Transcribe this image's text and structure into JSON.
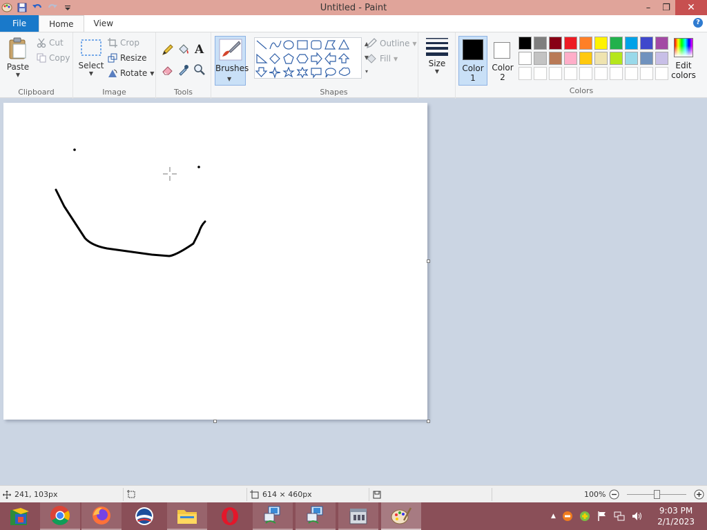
{
  "window": {
    "title": "Untitled - Paint",
    "minimize": "–",
    "restore": "❐",
    "close": "✕"
  },
  "tabs": [
    {
      "label": "File"
    },
    {
      "label": "Home"
    },
    {
      "label": "View"
    }
  ],
  "help_glyph": "?",
  "clipboard": {
    "paste": "Paste",
    "cut": "Cut",
    "copy": "Copy",
    "group": "Clipboard"
  },
  "image": {
    "select": "Select",
    "crop": "Crop",
    "resize": "Resize",
    "rotate": "Rotate",
    "group": "Image"
  },
  "tools": {
    "group": "Tools"
  },
  "brushes": {
    "label": "Brushes"
  },
  "shapes": {
    "outline": "Outline",
    "fill": "Fill",
    "group": "Shapes"
  },
  "size": {
    "label": "Size"
  },
  "colors": {
    "color1_line1": "Color",
    "color1_line2": "1",
    "color2_line1": "Color",
    "color2_line2": "2",
    "edit_line1": "Edit",
    "edit_line2": "colors",
    "group": "Colors",
    "color1_value": "#000000",
    "color2_value": "#ffffff",
    "palette_row1": [
      "#000000",
      "#7f7f7f",
      "#880015",
      "#ed1c24",
      "#ff7f27",
      "#fff200",
      "#22b14c",
      "#00a2e8",
      "#3f48cc",
      "#a349a4"
    ],
    "palette_row2": [
      "#ffffff",
      "#c3c3c3",
      "#b97a57",
      "#ffaec9",
      "#ffc90e",
      "#efe4b0",
      "#b5e61d",
      "#99d9ea",
      "#7092be",
      "#c8bfe7"
    ]
  },
  "status": {
    "cursor_pos": "241, 103px",
    "canvas_size": "614 × 460px",
    "zoom": "100%",
    "zoom_fraction": 0.5
  },
  "clock": {
    "time": "9:03 PM",
    "date": "2/1/2023"
  }
}
